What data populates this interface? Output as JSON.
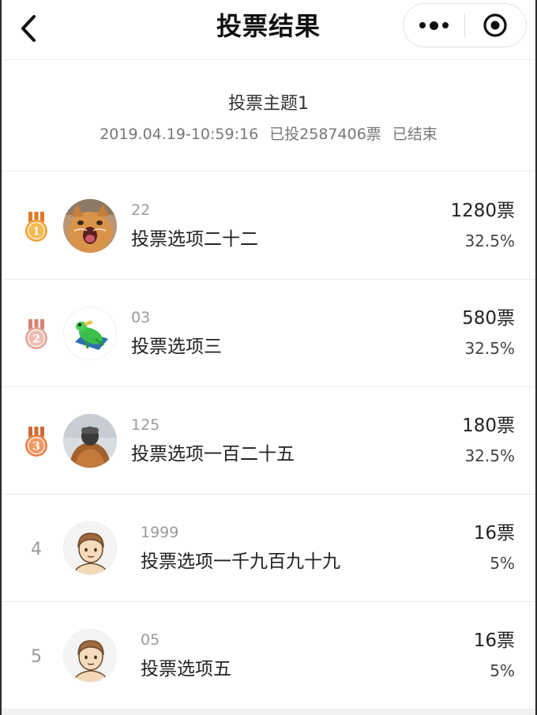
{
  "navbar": {
    "title": "投票结果",
    "back_icon": "chevron-left-icon",
    "more_icon": "more-dots-icon",
    "close_icon": "target-circle-icon"
  },
  "vote": {
    "title": "投票主题1",
    "datetime": "2019.04.19-10:59:16",
    "total": "已投2587406票",
    "status": "已结束"
  },
  "results": [
    {
      "rank": "1",
      "rank_badge": "gold-medal-icon",
      "avatar": "cat-photo",
      "code": "22",
      "name": "投票选项二十二",
      "votes": "1280票",
      "percent": "32.5%"
    },
    {
      "rank": "2",
      "rank_badge": "silver-medal-icon",
      "avatar": "frog-illustration",
      "code": "03",
      "name": "投票选项三",
      "votes": "580票",
      "percent": "32.5%"
    },
    {
      "rank": "3",
      "rank_badge": "bronze-medal-icon",
      "avatar": "person-photo",
      "code": "125",
      "name": "投票选项一百二十五",
      "votes": "180票",
      "percent": "32.5%"
    },
    {
      "rank": "4",
      "avatar": "default-avatar",
      "code": "1999",
      "name": "投票选项一千九百九十九",
      "votes": "16票",
      "percent": "5%"
    },
    {
      "rank": "5",
      "avatar": "default-avatar",
      "code": "05",
      "name": "投票选项五",
      "votes": "16票",
      "percent": "5%"
    }
  ],
  "colors": {
    "gold": "#f0a23a",
    "silver": "#e3a69c",
    "bronze": "#e8834e",
    "divider": "#ececec"
  }
}
